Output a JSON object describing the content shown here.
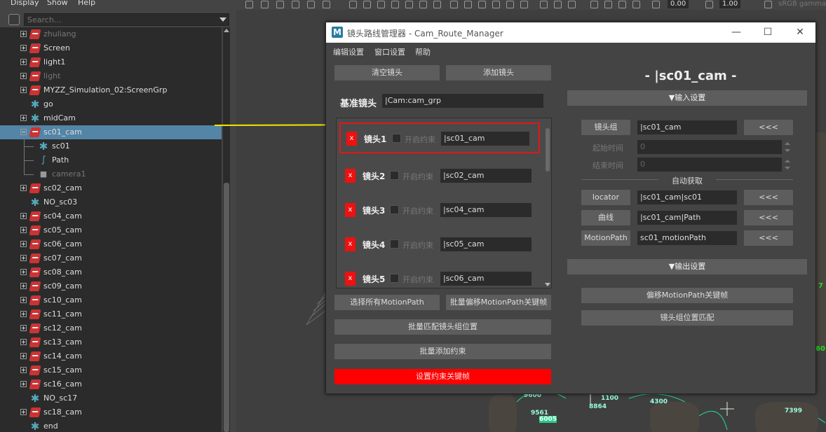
{
  "outliner": {
    "menu": [
      "Display",
      "Show",
      "Help"
    ],
    "search_placeholder": "Search...",
    "items": [
      {
        "label": "zhuliang",
        "icon": "camera-group-icon",
        "expander": "plus",
        "dim": true
      },
      {
        "label": "Screen",
        "icon": "camera-group-icon",
        "expander": "plus"
      },
      {
        "label": "light1",
        "icon": "camera-group-icon",
        "expander": "plus"
      },
      {
        "label": "light",
        "icon": "camera-group-icon",
        "expander": "plus",
        "dim": true
      },
      {
        "label": "MYZZ_Simulation_02:ScreenGrp",
        "icon": "camera-group-icon",
        "expander": "plus"
      },
      {
        "label": "go",
        "icon": "locator-icon"
      },
      {
        "label": "midCam",
        "icon": "locator-icon",
        "expander": "plus"
      },
      {
        "label": "sc01_cam",
        "icon": "camera-group-icon",
        "expander": "minus",
        "selected": true
      },
      {
        "label": "sc01",
        "icon": "locator-icon",
        "child": true
      },
      {
        "label": "Path",
        "icon": "curve-icon",
        "child": true
      },
      {
        "label": "camera1",
        "icon": "camera-icon",
        "child": true,
        "dim": true
      },
      {
        "label": "sc02_cam",
        "icon": "camera-group-icon",
        "expander": "plus"
      },
      {
        "label": "NO_sc03",
        "icon": "locator-icon"
      },
      {
        "label": "sc04_cam",
        "icon": "camera-group-icon",
        "expander": "plus"
      },
      {
        "label": "sc05_cam",
        "icon": "camera-group-icon",
        "expander": "plus"
      },
      {
        "label": "sc06_cam",
        "icon": "camera-group-icon",
        "expander": "plus"
      },
      {
        "label": "sc07_cam",
        "icon": "camera-group-icon",
        "expander": "plus"
      },
      {
        "label": "sc08_cam",
        "icon": "camera-group-icon",
        "expander": "plus"
      },
      {
        "label": "sc09_cam",
        "icon": "camera-group-icon",
        "expander": "plus"
      },
      {
        "label": "sc10_cam",
        "icon": "camera-group-icon",
        "expander": "plus"
      },
      {
        "label": "sc11_cam",
        "icon": "camera-group-icon",
        "expander": "plus"
      },
      {
        "label": "sc12_cam",
        "icon": "camera-group-icon",
        "expander": "plus"
      },
      {
        "label": "sc13_cam",
        "icon": "camera-group-icon",
        "expander": "plus"
      },
      {
        "label": "sc14_cam",
        "icon": "camera-group-icon",
        "expander": "plus"
      },
      {
        "label": "sc15_cam",
        "icon": "camera-group-icon",
        "expander": "plus"
      },
      {
        "label": "sc16_cam",
        "icon": "camera-group-icon",
        "expander": "plus"
      },
      {
        "label": "NO_sc17",
        "icon": "locator-icon"
      },
      {
        "label": "sc18_cam",
        "icon": "camera-group-icon",
        "expander": "plus"
      },
      {
        "label": "end",
        "icon": "locator-icon"
      }
    ]
  },
  "viewport_toolbar": {
    "field1": "0.00",
    "field2": "1.00",
    "color_space": "sRGB gamma"
  },
  "scene_labels": [
    "9600",
    "9561",
    "6005",
    "8864",
    "1100",
    "4300",
    "7399",
    "7",
    "60"
  ],
  "window": {
    "title": "镜头路线管理器 - Cam_Route_Manager",
    "controls": {
      "minimize": "—",
      "maximize": "☐",
      "close": "✕"
    },
    "menu": [
      "编辑设置",
      "窗口设置",
      "帮助"
    ],
    "left": {
      "clear_button": "清空镜头",
      "add_button": "添加镜头",
      "base_label": "基准镜头",
      "base_value": "|Cam:cam_grp",
      "cameras": [
        {
          "x": "x",
          "name": "镜头1",
          "checkbox_label": "开启约束",
          "value": "|sc01_cam"
        },
        {
          "x": "x",
          "name": "镜头2",
          "checkbox_label": "开启约束",
          "value": "|sc02_cam"
        },
        {
          "x": "x",
          "name": "镜头3",
          "checkbox_label": "开启约束",
          "value": "|sc04_cam"
        },
        {
          "x": "x",
          "name": "镜头4",
          "checkbox_label": "开启约束",
          "value": "|sc05_cam"
        },
        {
          "x": "x",
          "name": "镜头5",
          "checkbox_label": "开启约束",
          "value": "|sc06_cam"
        }
      ],
      "select_motionpath_button": "选择所有MotionPath",
      "batch_offset_button": "批量偏移MotionPath关键帧",
      "batch_match_button": "批量匹配镜头组位置",
      "batch_add_constraint_button": "批量添加约束",
      "set_constraint_key_button": "设置约束关键帧"
    },
    "right": {
      "current_camera": "- |sc01_cam -",
      "input_header": "▼输入设置",
      "cam_group_button": "镜头组",
      "cam_group_value": "|sc01_cam",
      "fetch_label": "<<<",
      "start_time_label": "起始时间",
      "start_time_value": "0",
      "end_time_label": "结束时间",
      "end_time_value": "0",
      "auto_fetch_label": "自动获取",
      "locator_button": "locator",
      "locator_value": "|sc01_cam|sc01",
      "curve_button": "曲线",
      "curve_value": "|sc01_cam|Path",
      "motionpath_button": "MotionPath",
      "motionpath_value": "sc01_motionPath",
      "output_header": "▼输出设置",
      "offset_keys_button": "偏移MotionPath关键帧",
      "match_position_button": "镜头组位置匹配"
    }
  },
  "colors": {
    "accent_red": "#ee1111",
    "selection_blue": "#5285a6",
    "arrow_yellow": "#f2e600"
  }
}
